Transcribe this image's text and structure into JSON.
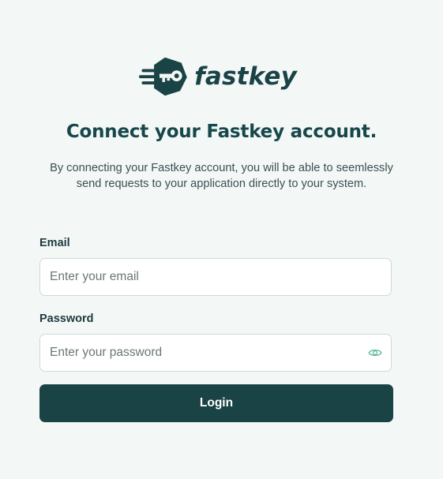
{
  "brand": {
    "name": "fastkey",
    "logo_icon": "key-hexagon-icon",
    "color": "#1a4346"
  },
  "header": {
    "title": "Connect your Fastkey account.",
    "description": "By connecting your Fastkey account, you will be able to seemlessly send requests to your application directly to your system."
  },
  "form": {
    "email": {
      "label": "Email",
      "placeholder": "Enter your email",
      "value": ""
    },
    "password": {
      "label": "Password",
      "placeholder": "Enter your password",
      "value": "",
      "toggle_icon": "eye-icon",
      "toggle_color": "#5fb996"
    },
    "submit_label": "Login"
  },
  "colors": {
    "background": "#f3f8f7",
    "primary": "#1a4346",
    "button_text": "#ffffff",
    "border": "#cfd9d8"
  }
}
